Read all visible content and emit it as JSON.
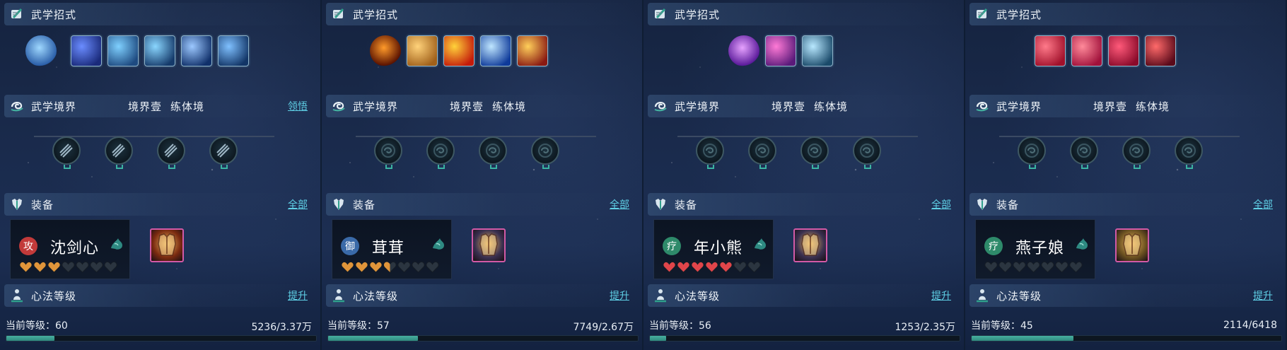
{
  "colors": {
    "link": "#5fd0e6",
    "exp_fill": "#3c9e90",
    "heart_gold": "#e0953a",
    "heart_red": "#e0454a",
    "heart_empty": "#2b3540",
    "gear_border": "#d25aa6",
    "node_stand": "#3bb3a2"
  },
  "panels": [
    {
      "skills_title": "武学招式",
      "skill_icons": [
        "swirl-orb-icon",
        "blue-slash-icon",
        "water-wave-icon",
        "ice-wind-icon",
        "lightning-strike-icon",
        "blue-blade-icon"
      ],
      "realm_title": "武学境界",
      "realm_level": "境界壹",
      "realm_stage": "练体境",
      "realm_link": "领悟",
      "realm_nodes": [
        "multi-blade-icon",
        "swirl-icon",
        "crossed-sword-icon",
        "dagger-icon"
      ],
      "equip_title": "装备",
      "equip_link": "全部",
      "equip_type": "攻",
      "equip_type_color": "#c23a3a",
      "equip_name": "沈剑心",
      "hearts": {
        "filled": 3,
        "half": 0,
        "total": 7,
        "color": "gold"
      },
      "gear_icon": "golden-armor-icon",
      "gear_bg": "#7a2a10",
      "mind_title": "心法等级",
      "mind_link": "提升",
      "level_label": "当前等级：60",
      "exp_text": "5236/3.37万",
      "exp_ratio": 0.155
    },
    {
      "skills_title": "武学招式",
      "skill_icons": [
        "fire-figure-icon",
        "buddha-face-icon",
        "fire-burst-icon",
        "blue-crescent-icon",
        "fire-vortex-icon"
      ],
      "realm_title": "武学境界",
      "realm_level": "境界壹",
      "realm_stage": "练体境",
      "realm_link": "",
      "realm_nodes": [
        "locked-swirl-icon",
        "locked-swirl-icon",
        "locked-swirl-icon",
        "locked-swirl-icon"
      ],
      "equip_title": "装备",
      "equip_link": "全部",
      "equip_type": "御",
      "equip_type_color": "#3a6aa8",
      "equip_name": "茸茸",
      "hearts": {
        "filled": 3,
        "half": 1,
        "total": 7,
        "color": "gold"
      },
      "gear_icon": "silver-armor-icon",
      "gear_bg": "#3a3050",
      "mind_title": "心法等级",
      "mind_link": "提升",
      "level_label": "当前等级：57",
      "exp_text": "7749/2.67万",
      "exp_ratio": 0.29
    },
    {
      "skills_title": "武学招式",
      "skill_icons": [
        "purple-spire-icon",
        "pink-creature-icon",
        "shark-fin-icon"
      ],
      "realm_title": "武学境界",
      "realm_level": "境界壹",
      "realm_stage": "练体境",
      "realm_link": "",
      "realm_nodes": [
        "locked-swirl-icon",
        "locked-swirl-icon",
        "locked-swirl-icon",
        "locked-swirl-icon"
      ],
      "equip_title": "装备",
      "equip_link": "全部",
      "equip_type": "疗",
      "equip_type_color": "#2e8a6a",
      "equip_name": "年小熊",
      "hearts": {
        "filled": 5,
        "half": 0,
        "total": 7,
        "color": "red"
      },
      "gear_icon": "silver-armor-icon",
      "gear_bg": "#3a3050",
      "mind_title": "心法等级",
      "mind_link": "提升",
      "level_label": "当前等级：56",
      "exp_text": "1253/2.35万",
      "exp_ratio": 0.053
    },
    {
      "skills_title": "武学招式",
      "skill_icons": [
        "red-slash-icon",
        "red-claw-icon",
        "rose-icon",
        "crimson-dancer-icon"
      ],
      "realm_title": "武学境界",
      "realm_level": "境界壹",
      "realm_stage": "练体境",
      "realm_link": "",
      "realm_nodes": [
        "locked-swirl-icon",
        "locked-swirl-icon",
        "locked-swirl-icon",
        "locked-swirl-icon"
      ],
      "equip_title": "装备",
      "equip_link": "全部",
      "equip_type": "疗",
      "equip_type_color": "#2e8a6a",
      "equip_name": "燕子娘",
      "hearts": {
        "filled": 0,
        "half": 0,
        "total": 7,
        "color": "gold"
      },
      "gear_icon": "golden-robe-icon",
      "gear_bg": "#6a5020",
      "mind_title": "心法等级",
      "mind_link": "提升",
      "level_label": "当前等级：45",
      "exp_text": "2114/6418",
      "exp_ratio": 0.329
    }
  ]
}
